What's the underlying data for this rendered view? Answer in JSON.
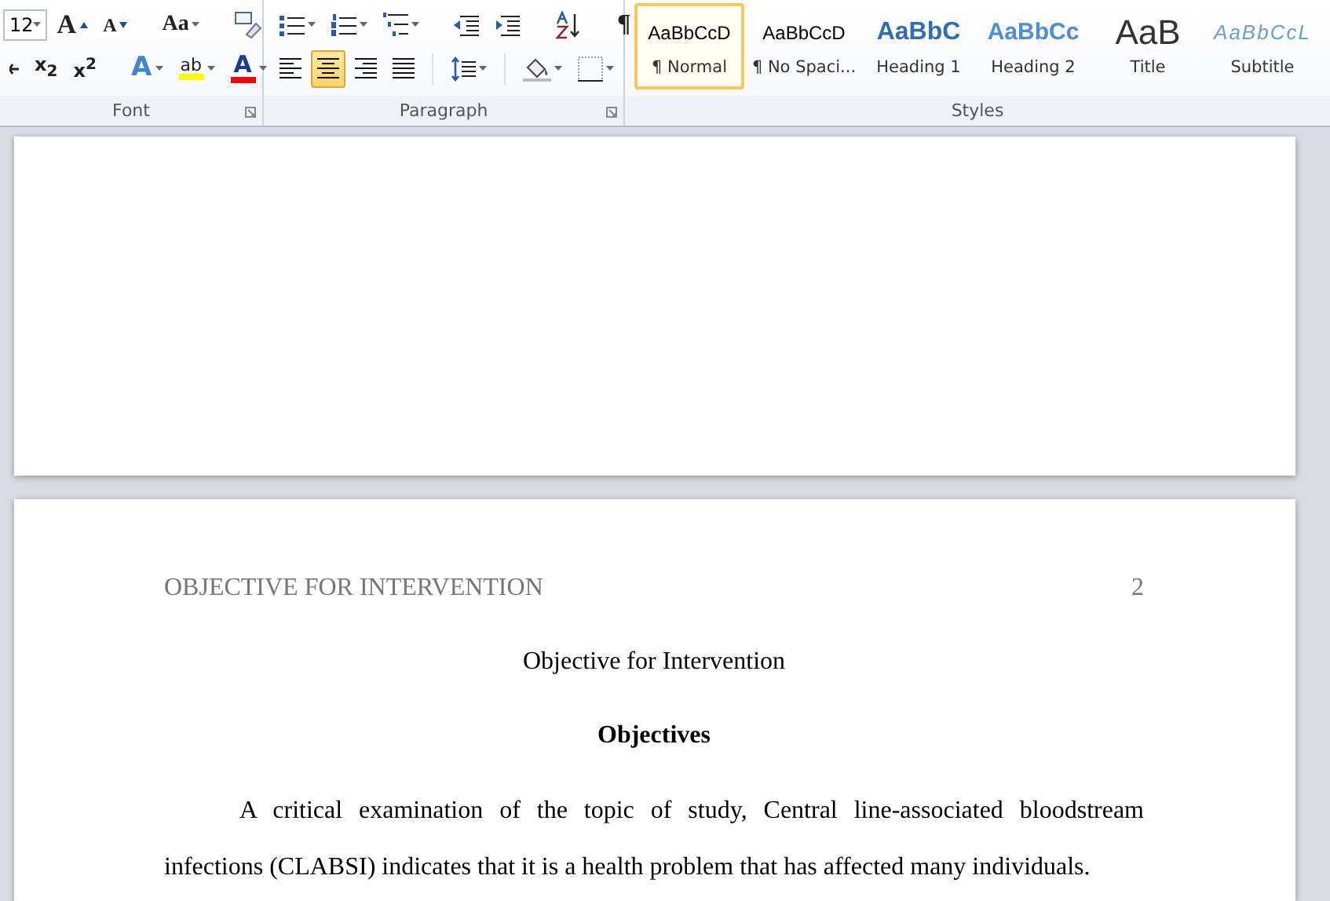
{
  "ribbon": {
    "font_group": {
      "label": "Font",
      "font_size": "12",
      "row1": [
        {
          "kind": "grow",
          "glyph": "A"
        },
        {
          "kind": "shrink",
          "glyph": "A"
        },
        {
          "kind": "case",
          "glyph": "Aa"
        },
        {
          "kind": "clear"
        }
      ],
      "row2": [
        {
          "kind": "cut"
        },
        {
          "kind": "subscript",
          "glyph": "x$_{2}$"
        },
        {
          "kind": "superscript",
          "glyph": "x$^{2}$"
        },
        {
          "kind": "effects",
          "glyph": "A"
        },
        {
          "kind": "highlight",
          "glyph": "ab",
          "color": "#ffff00"
        },
        {
          "kind": "fontcolor",
          "glyph": "A",
          "color": "#ff0000"
        }
      ]
    },
    "paragraph_group": {
      "label": "Paragraph",
      "row1": [
        {
          "kind": "bullets"
        },
        {
          "kind": "numbering"
        },
        {
          "kind": "multilevel"
        },
        {
          "kind": "decrease_indent"
        },
        {
          "kind": "increase_indent"
        },
        {
          "kind": "sort"
        },
        {
          "kind": "pilcrow",
          "glyph": "¶"
        }
      ],
      "alignment": [
        {
          "kind": "left",
          "selected": false
        },
        {
          "kind": "center",
          "selected": true
        },
        {
          "kind": "right",
          "selected": false
        },
        {
          "kind": "justify",
          "selected": false
        }
      ],
      "row2": [
        {
          "kind": "line_spacing"
        },
        {
          "kind": "shading"
        },
        {
          "kind": "borders"
        }
      ]
    },
    "styles_group": {
      "label": "Styles",
      "styles": [
        {
          "kind": "normal",
          "preview": "AaBbCcD",
          "label": "¶ Normal",
          "selected": true
        },
        {
          "kind": "no_spacing",
          "preview": "AaBbCcD",
          "label": "¶ No Spaci...",
          "selected": false
        },
        {
          "kind": "heading1",
          "preview": "AaBbC",
          "label": "Heading 1",
          "selected": false
        },
        {
          "kind": "heading2",
          "preview": "AaBbCc",
          "label": "Heading 2",
          "selected": false
        },
        {
          "kind": "title",
          "preview": "AaB",
          "label": "Title",
          "selected": false
        },
        {
          "kind": "subtitle",
          "preview": "AaBbCcL",
          "label": "Subtitle",
          "selected": false
        }
      ]
    }
  },
  "document": {
    "header": {
      "running_head": "OBJECTIVE FOR INTERVENTION",
      "page_number": "2"
    },
    "title": "Objective for Intervention",
    "heading": "Objectives",
    "paragraph_lines": [
      "A critical examination of the topic of study, Central line-associated bloodstream",
      "infections (CLABSI) indicates that it is a health problem that has affected many individuals."
    ]
  }
}
